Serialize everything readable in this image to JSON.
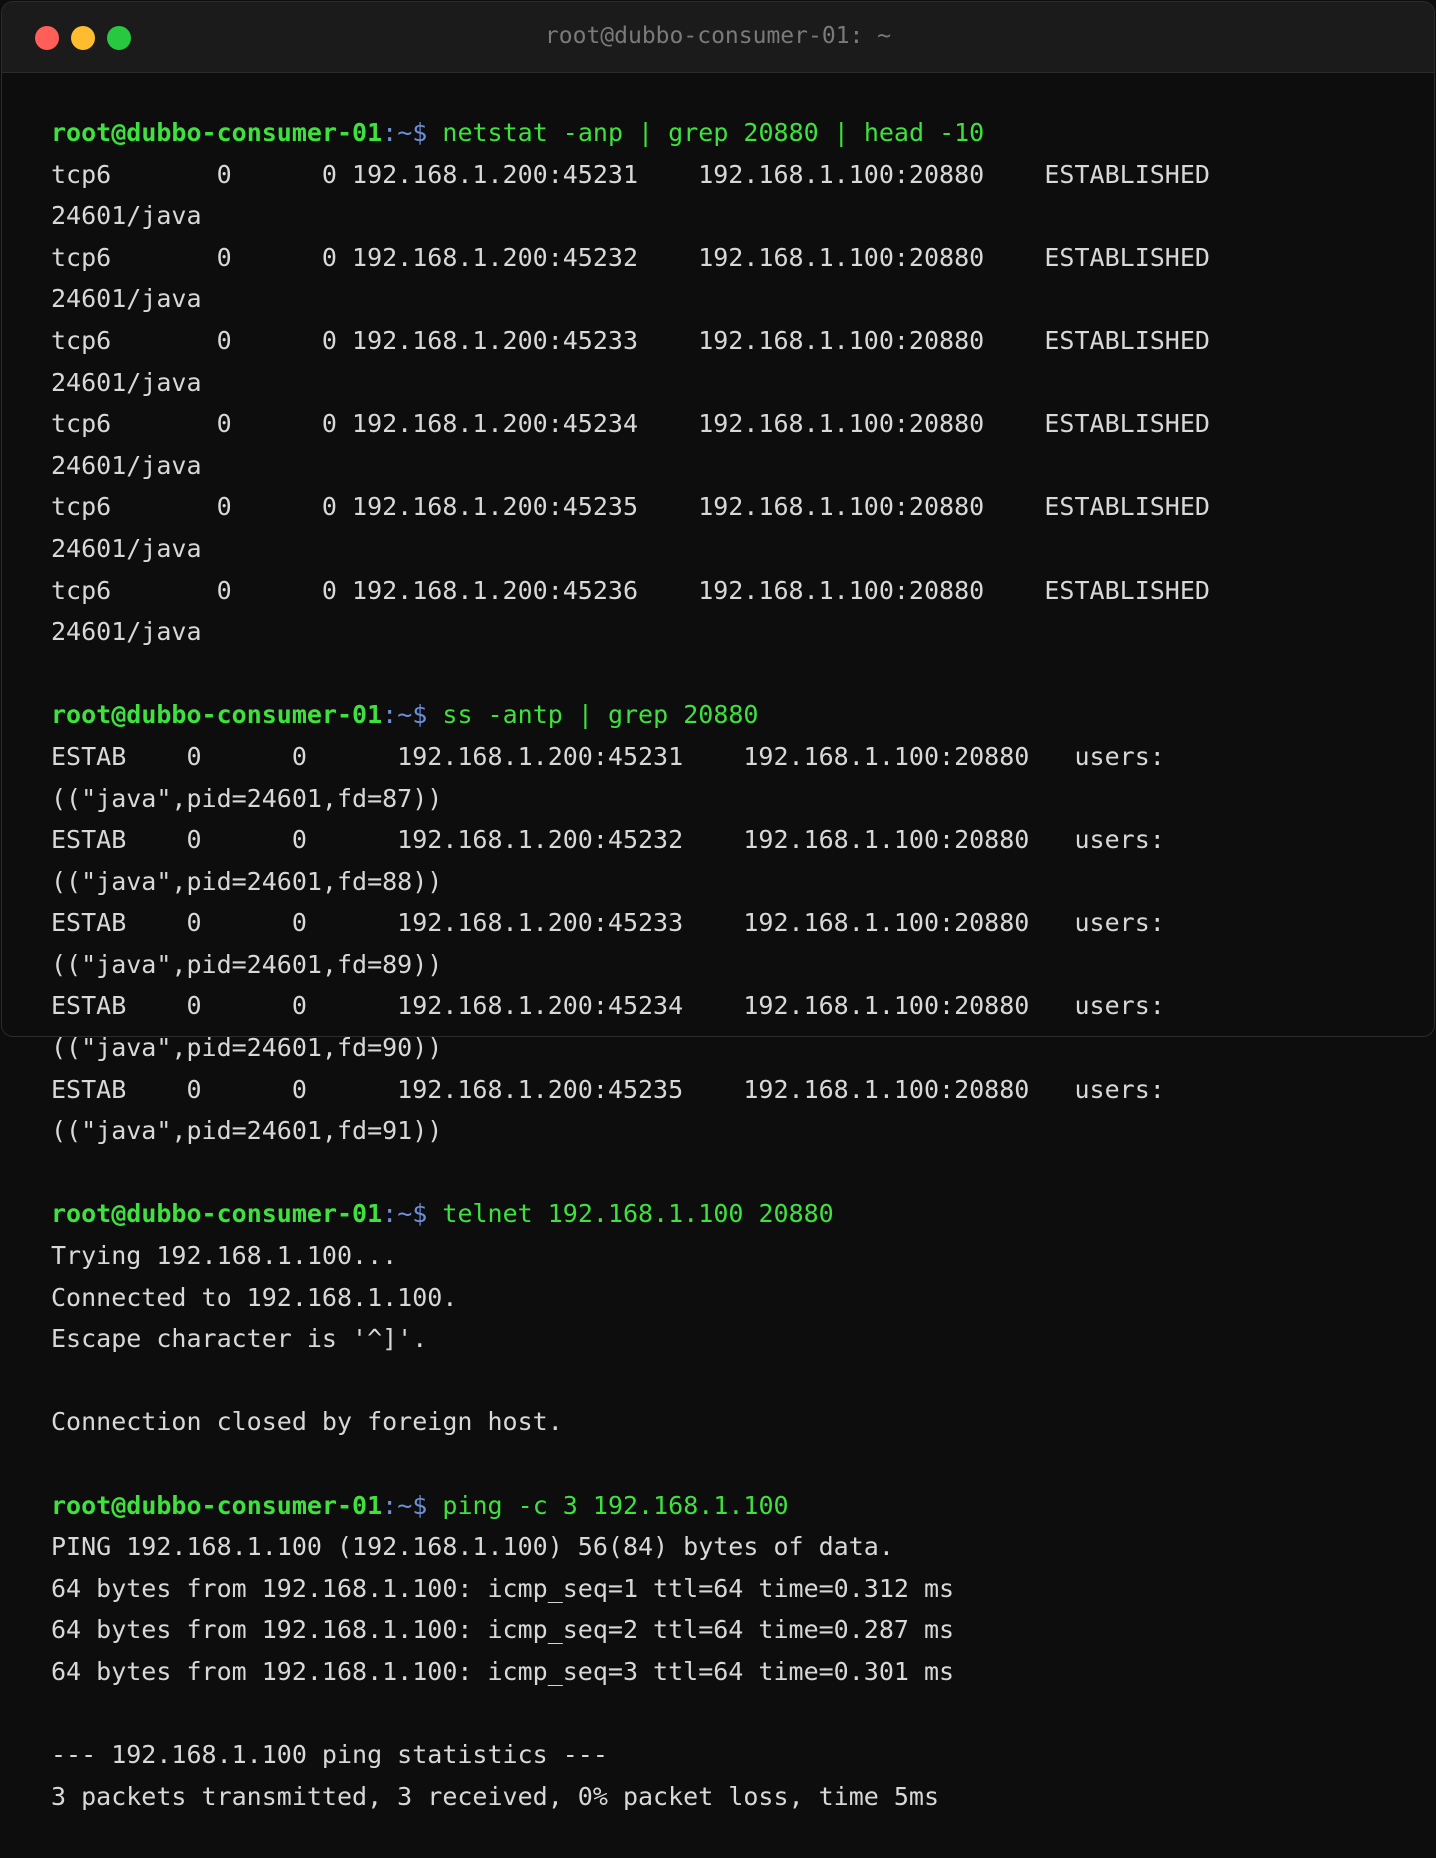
{
  "window": {
    "title": "root@dubbo-consumer-01: ~",
    "colors": {
      "close": "#ff5f57",
      "minimize": "#febc2e",
      "maximize": "#28c840",
      "prompt": "#3ee13e",
      "path": "#6e8fd8",
      "output": "#d8d8d8",
      "background": "#0d0d0d"
    }
  },
  "prompt": {
    "user": "root",
    "at": "@",
    "host": "dubbo-consumer-01",
    "sep": ":",
    "path": "~",
    "symbol": "$ "
  },
  "blocks": [
    {
      "command": "netstat -anp | grep 20880 | head -10",
      "output": [
        "tcp6       0      0 192.168.1.200:45231    192.168.1.100:20880    ESTABLISHED",
        "24601/java",
        "tcp6       0      0 192.168.1.200:45232    192.168.1.100:20880    ESTABLISHED",
        "24601/java",
        "tcp6       0      0 192.168.1.200:45233    192.168.1.100:20880    ESTABLISHED",
        "24601/java",
        "tcp6       0      0 192.168.1.200:45234    192.168.1.100:20880    ESTABLISHED",
        "24601/java",
        "tcp6       0      0 192.168.1.200:45235    192.168.1.100:20880    ESTABLISHED",
        "24601/java",
        "tcp6       0      0 192.168.1.200:45236    192.168.1.100:20880    ESTABLISHED",
        "24601/java",
        ""
      ]
    },
    {
      "command": "ss -antp | grep 20880",
      "output": [
        "ESTAB    0      0      192.168.1.200:45231    192.168.1.100:20880   users:",
        "((\"java\",pid=24601,fd=87))",
        "ESTAB    0      0      192.168.1.200:45232    192.168.1.100:20880   users:",
        "((\"java\",pid=24601,fd=88))",
        "ESTAB    0      0      192.168.1.200:45233    192.168.1.100:20880   users:",
        "((\"java\",pid=24601,fd=89))",
        "ESTAB    0      0      192.168.1.200:45234    192.168.1.100:20880   users:",
        "((\"java\",pid=24601,fd=90))",
        "ESTAB    0      0      192.168.1.200:45235    192.168.1.100:20880   users:",
        "((\"java\",pid=24601,fd=91))",
        ""
      ]
    },
    {
      "command": "telnet 192.168.1.100 20880",
      "output": [
        "Trying 192.168.1.100...",
        "Connected to 192.168.1.100.",
        "Escape character is '^]'.",
        "",
        "Connection closed by foreign host.",
        ""
      ]
    },
    {
      "command": "ping -c 3 192.168.1.100",
      "output": [
        "PING 192.168.1.100 (192.168.1.100) 56(84) bytes of data.",
        "64 bytes from 192.168.1.100: icmp_seq=1 ttl=64 time=0.312 ms",
        "64 bytes from 192.168.1.100: icmp_seq=2 ttl=64 time=0.287 ms",
        "64 bytes from 192.168.1.100: icmp_seq=3 ttl=64 time=0.301 ms",
        "",
        "--- 192.168.1.100 ping statistics ---",
        "3 packets transmitted, 3 received, 0% packet loss, time 5ms"
      ]
    }
  ]
}
